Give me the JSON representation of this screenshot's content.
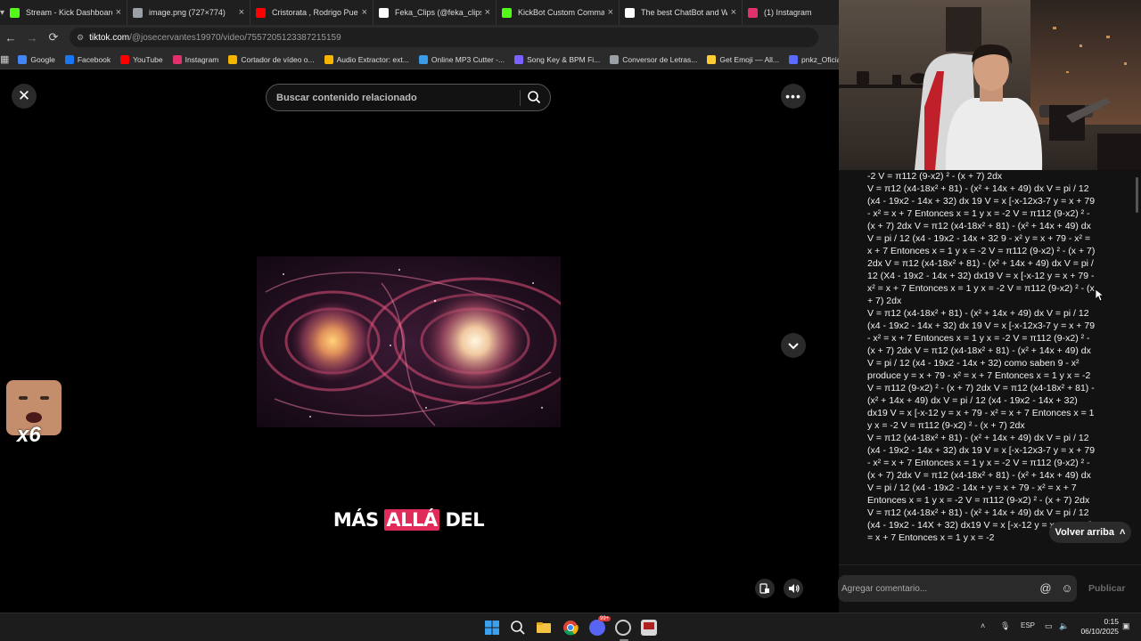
{
  "browser": {
    "tabs": [
      {
        "label": "Stream - Kick Dashboard",
        "icon": "kick-icon",
        "color": "#53fc18"
      },
      {
        "label": "image.png (727×774)",
        "icon": "globe-icon",
        "color": "#9aa0a6"
      },
      {
        "label": "Cristorata , Rodrigo Puente",
        "icon": "youtube-icon",
        "color": "#ff0000"
      },
      {
        "label": "Feka_Clips (@feka_clips) |",
        "icon": "tiktok-icon",
        "color": "#ffffff"
      },
      {
        "label": "KickBot Custom Comman",
        "icon": "kickbot-icon",
        "color": "#53fc18"
      },
      {
        "label": "The best ChatBot and Wi",
        "icon": "chatbot-icon",
        "color": "#ffffff"
      },
      {
        "label": "(1) Instagram",
        "icon": "instagram-icon",
        "color": "#e1306c"
      }
    ],
    "tab_close_glyph": "×",
    "url_host": "tiktok.com",
    "url_path": "/@josecervantes19970/video/7557205123387215159",
    "bookmarks": [
      {
        "label": "Google",
        "color": "#4285f4"
      },
      {
        "label": "Facebook",
        "color": "#1877f2"
      },
      {
        "label": "YouTube",
        "color": "#ff0000"
      },
      {
        "label": "Instagram",
        "color": "#e1306c"
      },
      {
        "label": "Cortador de vídeo o...",
        "color": "#f4b400"
      },
      {
        "label": "Audio Extractor: ext...",
        "color": "#f4b400"
      },
      {
        "label": "Online MP3 Cutter -...",
        "color": "#3c9be8"
      },
      {
        "label": "Song Key & BPM Fi...",
        "color": "#7b61ff"
      },
      {
        "label": "Conversor de Letras...",
        "color": "#9aa0a6"
      },
      {
        "label": "Get Emoji — All...",
        "color": "#ffcc33"
      },
      {
        "label": "pnkz_Oficial",
        "color": "#5b6bff"
      }
    ]
  },
  "tiktok": {
    "search_placeholder": "Buscar contenido relacionado",
    "caption_before": "MÁS ",
    "caption_highlight": "ALLÁ",
    "caption_after": " DEL",
    "sticker_text": "x6",
    "comment_paragraphs": [
      "-2 V = π112 (9-x2) ² - (x + 7) 2dx",
      "V = π12 (x4-18x² + 81) - (x² + 14x + 49) dx V = pi / 12 (x4 - 19x2 - 14x + 32) dx 19 V = x [-x-12x3-7 y = x + 79 - x² = x + 7 Entonces x = 1 y x = -2 V = π112 (9-x2) ² - (x + 7) 2dx V = π12 (x4-18x² + 81) - (x² + 14x + 49) dx V = pi / 12 (x4 - 19x2 - 14x + 32 9 - x² y = x + 79 - x² = x + 7 Entonces x = 1 y x = -2 V = π112 (9-x2) ² - (x + 7) 2dx V = π12 (x4-18x² + 81) - (x² + 14x + 49) dx V = pi / 12 (X4 - 19x2 - 14x + 32) dx19 V = x [-x-12 y = x + 79 - x² = x + 7 Entonces x = 1 y x = -2 V = π112 (9-x2) ² - (x + 7) 2dx",
      "V = π12 (x4-18x² + 81) - (x² + 14x + 49) dx V = pi / 12 (x4 - 19x2 - 14x + 32) dx 19 V = x [-x-12x3-7 y = x + 79 - x² = x + 7 Entonces x = 1 y x = -2 V = π112 (9-x2) ² - (x + 7) 2dx V = π12 (x4-18x² + 81) - (x² + 14x + 49) dx V = pi / 12 (x4 - 19x2 - 14x + 32) como saben 9 - x² produce y = x + 79 - x² = x + 7 Entonces x = 1 y x = -2 V = π112 (9-x2) ² - (x + 7) 2dx V = π12 (x4-18x² + 81) - (x² + 14x + 49) dx V = pi / 12 (x4 - 19x2 - 14x + 32) dx19 V = x [-x-12 y = x + 79 - x² = x + 7 Entonces x = 1 y x = -2 V = π112 (9-x2) ² - (x + 7) 2dx",
      "V = π12 (x4-18x² + 81) - (x² + 14x + 49) dx V = pi / 12 (x4 - 19x2 - 14x + 32) dx 19 V = x [-x-12x3-7 y = x + 79 - x² = x + 7 Entonces x = 1 y x = -2 V = π112 (9-x2) ² - (x + 7) 2dx V = π12 (x4-18x² + 81) - (x² + 14x + 49) dx V = pi / 12 (x4 - 19x2 - 14x + y = x + 79 - x² = x + 7 Entonces x = 1 y x = -2 V = π112 (9-x2) ² - (x + 7) 2dx V = π12 (x4-18x² + 81) - (x² + 14x + 49) dx V = pi / 12 (x4 - 19x2 - 14X + 32) dx19 V = x [-x-12 y = x + 79 - x² = x + 7 Entonces x = 1 y x = -2"
    ],
    "back_to_top": "Volver arriba",
    "back_to_top_glyph": "˄",
    "comment_placeholder": "Agregar comentario...",
    "publish": "Publicar"
  },
  "taskbar": {
    "lang": "ESP",
    "time": "0:15",
    "date": "06/10/2025",
    "chat_badge": "99+"
  }
}
